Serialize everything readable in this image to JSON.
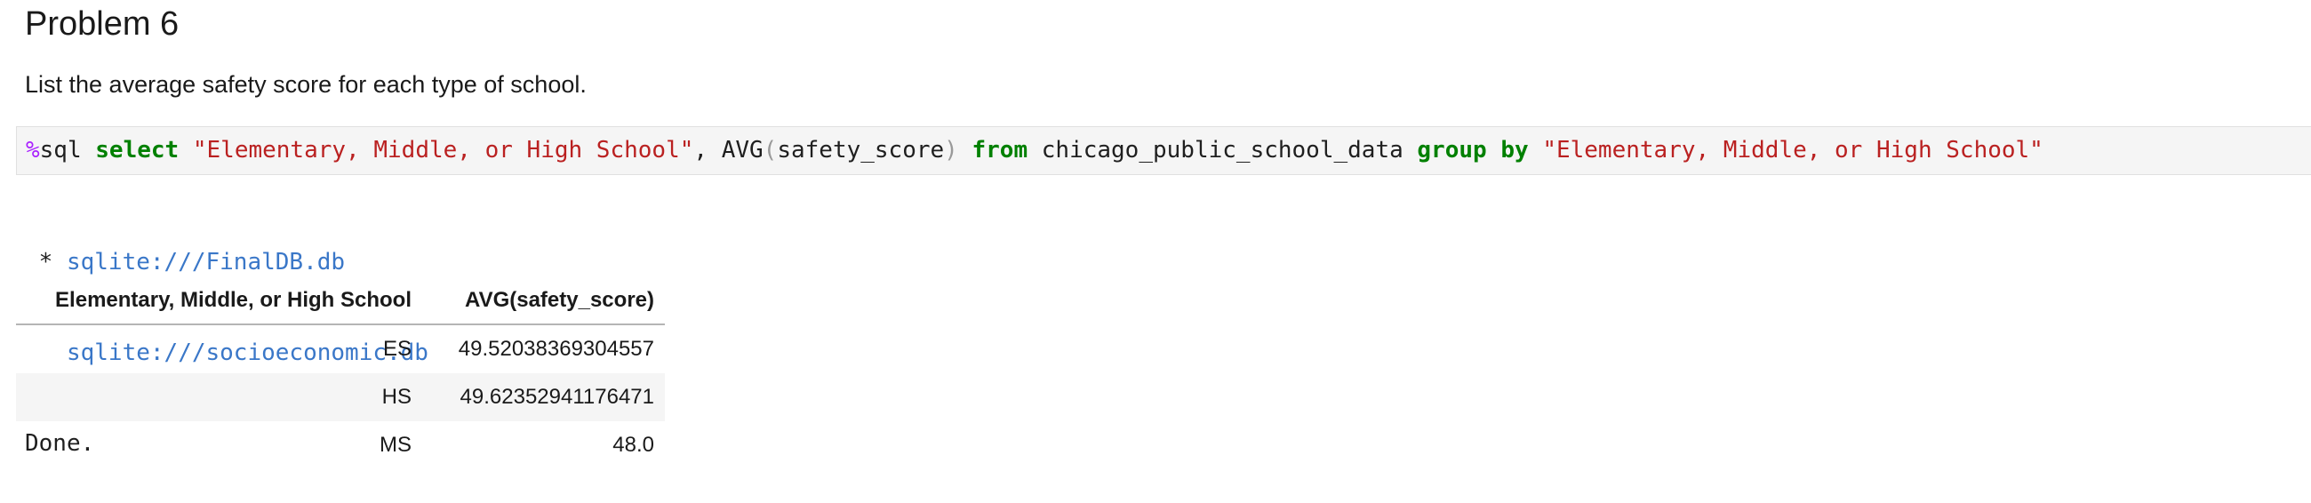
{
  "markdown": {
    "heading": "Problem 6",
    "paragraph": "List the average safety score for each type of school."
  },
  "code_cell": {
    "tokens": [
      {
        "text": "%",
        "kind": "magic"
      },
      {
        "text": "sql ",
        "kind": "plain"
      },
      {
        "text": "select",
        "kind": "kw"
      },
      {
        "text": " ",
        "kind": "plain"
      },
      {
        "text": "\"Elementary, Middle, or High School\"",
        "kind": "str"
      },
      {
        "text": ", AVG",
        "kind": "plain"
      },
      {
        "text": "(",
        "kind": "paren"
      },
      {
        "text": "safety_score",
        "kind": "plain"
      },
      {
        "text": ")",
        "kind": "paren"
      },
      {
        "text": " ",
        "kind": "plain"
      },
      {
        "text": "from",
        "kind": "kw"
      },
      {
        "text": " chicago_public_school_data ",
        "kind": "plain"
      },
      {
        "text": "group",
        "kind": "kw"
      },
      {
        "text": " ",
        "kind": "plain"
      },
      {
        "text": "by",
        "kind": "kw"
      },
      {
        "text": " ",
        "kind": "plain"
      },
      {
        "text": "\"Elementary, Middle, or High School\"",
        "kind": "str"
      }
    ]
  },
  "output": {
    "connections": [
      {
        "prefix": " * ",
        "link": "sqlite:///FinalDB.db"
      },
      {
        "prefix": "   ",
        "link": "sqlite:///socioeconomic.db"
      }
    ],
    "status": "Done."
  },
  "result_table": {
    "columns": [
      "Elementary, Middle, or High School",
      "AVG(safety_score)"
    ],
    "rows": [
      [
        "ES",
        "49.52038369304557"
      ],
      [
        "HS",
        "49.62352941176471"
      ],
      [
        "MS",
        "48.0"
      ]
    ]
  },
  "colors": {
    "keyword": "#008000",
    "string": "#ba2121",
    "magic": "#aa22ff",
    "link": "#3a77c8",
    "cell_background": "#f5f5f5"
  }
}
